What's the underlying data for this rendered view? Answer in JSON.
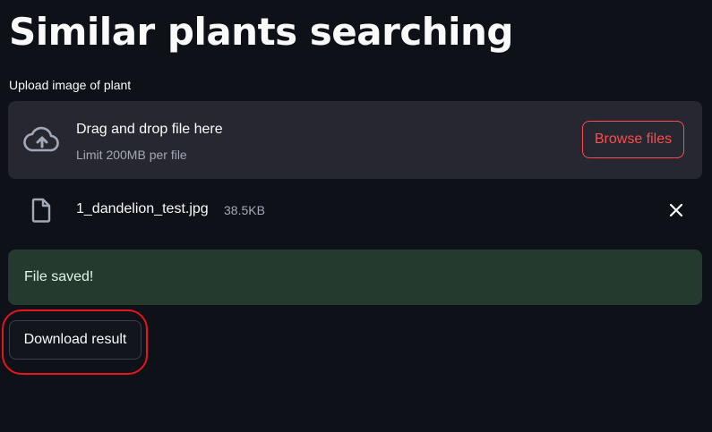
{
  "header": {
    "title": "Similar plants searching"
  },
  "uploader": {
    "label": "Upload image of plant",
    "dropzone": {
      "title": "Drag and drop file here",
      "limit": "Limit 200MB per file",
      "browse_label": "Browse files",
      "icon": "cloud-upload-icon"
    },
    "file": {
      "name": "1_dandelion_test.jpg",
      "size": "38.5KB",
      "icon": "file-icon",
      "remove_icon": "close-icon"
    }
  },
  "alert": {
    "message": "File saved!",
    "background": "#243a2f"
  },
  "actions": {
    "download_label": "Download result"
  },
  "colors": {
    "background": "#0e1117",
    "surface": "#262730",
    "accent": "#ff4b4b",
    "muted_text": "#a3a8b8",
    "annotation": "#e8141c"
  }
}
